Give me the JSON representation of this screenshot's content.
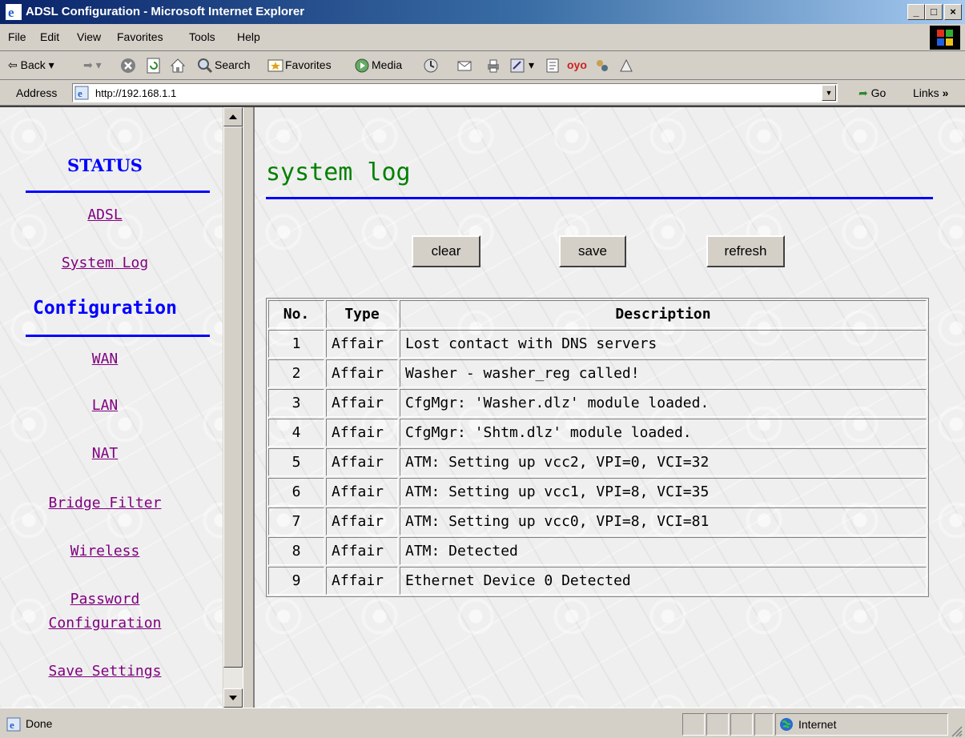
{
  "window": {
    "title": "ADSL Configuration - Microsoft Internet Explorer"
  },
  "menu": [
    "File",
    "Edit",
    "View",
    "Favorites",
    "Tools",
    "Help"
  ],
  "toolbar": {
    "back": "Back",
    "search": "Search",
    "favorites": "Favorites",
    "media": "Media"
  },
  "address": {
    "label": "Address",
    "url": "http://192.168.1.1",
    "go": "Go",
    "links": "Links"
  },
  "nav": {
    "status_header": "STATUS",
    "status_links": [
      "ADSL",
      "System Log"
    ],
    "config_header": "Configuration",
    "config_links": [
      "WAN",
      "LAN",
      "NAT",
      "Bridge Filter",
      "Wireless"
    ],
    "password_link": [
      "Password",
      "Configuration"
    ],
    "save_link": "Save Settings"
  },
  "main": {
    "title": "system log",
    "buttons": {
      "clear": "clear",
      "save": "save",
      "refresh": "refresh"
    },
    "columns": [
      "No.",
      "Type",
      "Description"
    ],
    "rows": [
      {
        "no": "1",
        "type": "Affair",
        "description": "Lost contact with DNS servers"
      },
      {
        "no": "2",
        "type": "Affair",
        "description": "Washer - washer_reg called!"
      },
      {
        "no": "3",
        "type": "Affair",
        "description": "CfgMgr: 'Washer.dlz' module loaded."
      },
      {
        "no": "4",
        "type": "Affair",
        "description": "CfgMgr: 'Shtm.dlz' module loaded."
      },
      {
        "no": "5",
        "type": "Affair",
        "description": "ATM: Setting up vcc2, VPI=0, VCI=32"
      },
      {
        "no": "6",
        "type": "Affair",
        "description": "ATM: Setting up vcc1, VPI=8, VCI=35"
      },
      {
        "no": "7",
        "type": "Affair",
        "description": "ATM: Setting up vcc0, VPI=8, VCI=81"
      },
      {
        "no": "8",
        "type": "Affair",
        "description": "ATM: Detected"
      },
      {
        "no": "9",
        "type": "Affair",
        "description": "Ethernet Device 0 Detected"
      }
    ]
  },
  "status": {
    "left": "Done",
    "zone": "Internet"
  },
  "colors": {
    "title_green": "#008000",
    "rule_blue": "#0000ff",
    "link_purple": "#800080",
    "titlebar": "#0a246a"
  }
}
